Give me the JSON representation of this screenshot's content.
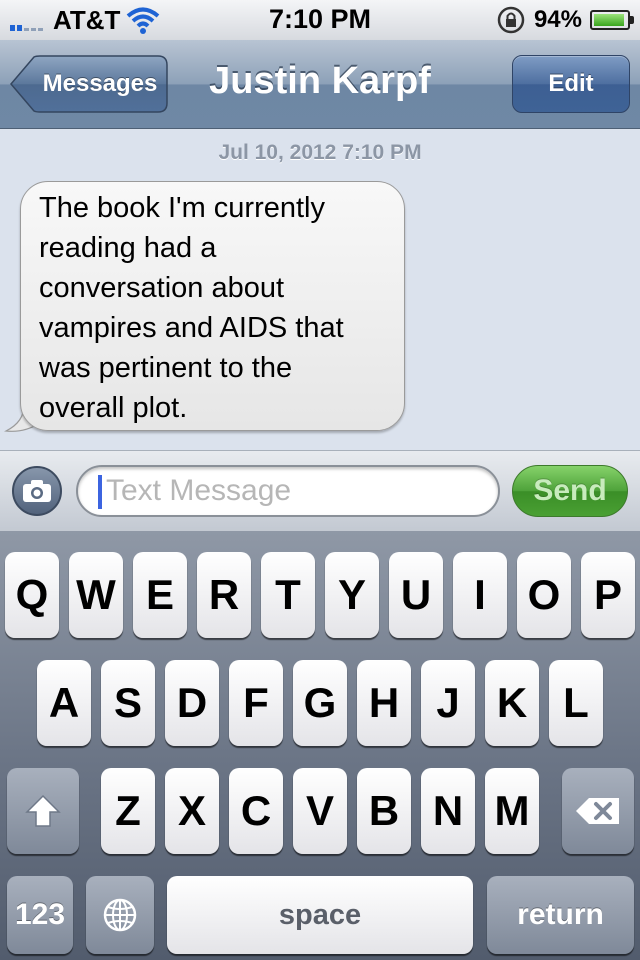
{
  "status_bar": {
    "carrier": "AT&T",
    "time": "7:10 PM",
    "battery_text": "94%",
    "battery_level": 0.94
  },
  "nav": {
    "back_label": "Messages",
    "title": "Justin Karpf",
    "edit_label": "Edit"
  },
  "conversation": {
    "timestamp": "Jul 10, 2012 7:10 PM",
    "messages": [
      {
        "text": "The book I'm currently reading had a conversation about vampires and AIDS that was pertinent to the overall plot."
      }
    ]
  },
  "composer": {
    "placeholder": "Text Message",
    "value": "",
    "send_label": "Send"
  },
  "keyboard": {
    "row1": [
      "Q",
      "W",
      "E",
      "R",
      "T",
      "Y",
      "U",
      "I",
      "O",
      "P"
    ],
    "row2": [
      "A",
      "S",
      "D",
      "F",
      "G",
      "H",
      "J",
      "K",
      "L"
    ],
    "row3": [
      "Z",
      "X",
      "C",
      "V",
      "B",
      "N",
      "M"
    ],
    "numbers_label": "123",
    "space_label": "space",
    "return_label": "return"
  },
  "colors": {
    "nav_bar": "#6f88a5",
    "conversation_bg": "#dbe2ed",
    "send_button": "#4ea23a",
    "keyboard_bg": "#6a7485"
  }
}
